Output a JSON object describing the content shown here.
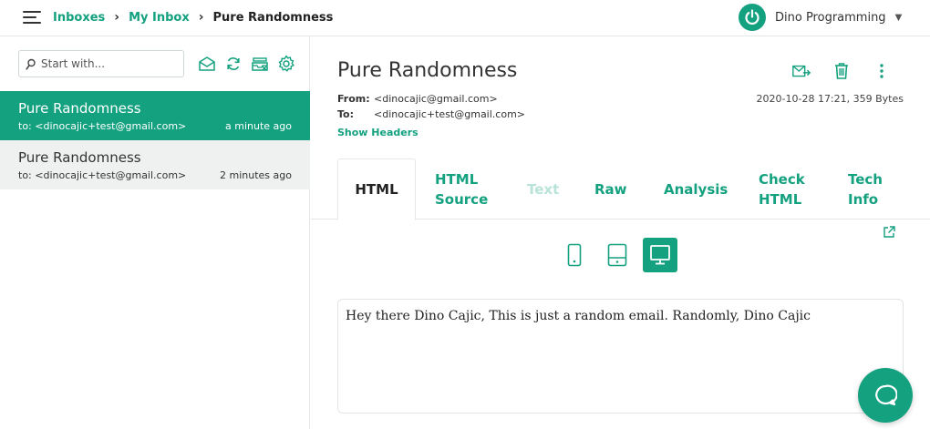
{
  "header": {
    "breadcrumb": [
      {
        "label": "Inboxes"
      },
      {
        "label": "My Inbox"
      },
      {
        "label": "Pure Randomness"
      }
    ],
    "user_name": "Dino Programming"
  },
  "sidebar": {
    "search_placeholder": "Start with...",
    "tools": [
      "mark-read-icon",
      "refresh-icon",
      "clear-inbox-icon",
      "settings-icon"
    ],
    "messages": [
      {
        "subject": "Pure Randomness",
        "to": "to: <dinocajic+test@gmail.com>",
        "time": "a minute ago",
        "active": true
      },
      {
        "subject": "Pure Randomness",
        "to": "to: <dinocajic+test@gmail.com>",
        "time": "2 minutes ago",
        "active": false
      }
    ]
  },
  "message": {
    "subject": "Pure Randomness",
    "from_label": "From:",
    "from_value": "<dinocajic@gmail.com>",
    "to_label": "To:",
    "to_value": "<dinocajic+test@gmail.com>",
    "date_size": "2020-10-28 17:21, 359 Bytes",
    "show_headers": "Show Headers",
    "body": "Hey there Dino Cajic, This is just a random email. Randomly, Dino Cajic"
  },
  "tabs": [
    {
      "label": "HTML",
      "state": "active"
    },
    {
      "label": "HTML Source",
      "state": "normal"
    },
    {
      "label": "Text",
      "state": "disabled"
    },
    {
      "label": "Raw",
      "state": "normal"
    },
    {
      "label": "Analysis",
      "state": "normal"
    },
    {
      "label": "Check HTML",
      "state": "normal"
    },
    {
      "label": "Tech Info",
      "state": "normal"
    }
  ],
  "devices": [
    {
      "name": "mobile",
      "active": false
    },
    {
      "name": "tablet",
      "active": false
    },
    {
      "name": "desktop",
      "active": true
    }
  ],
  "colors": {
    "accent": "#14a17f",
    "selected_row": "#14a17f",
    "inactive_row": "#eef1f0",
    "disabled_tab": "#b9e3d8"
  }
}
